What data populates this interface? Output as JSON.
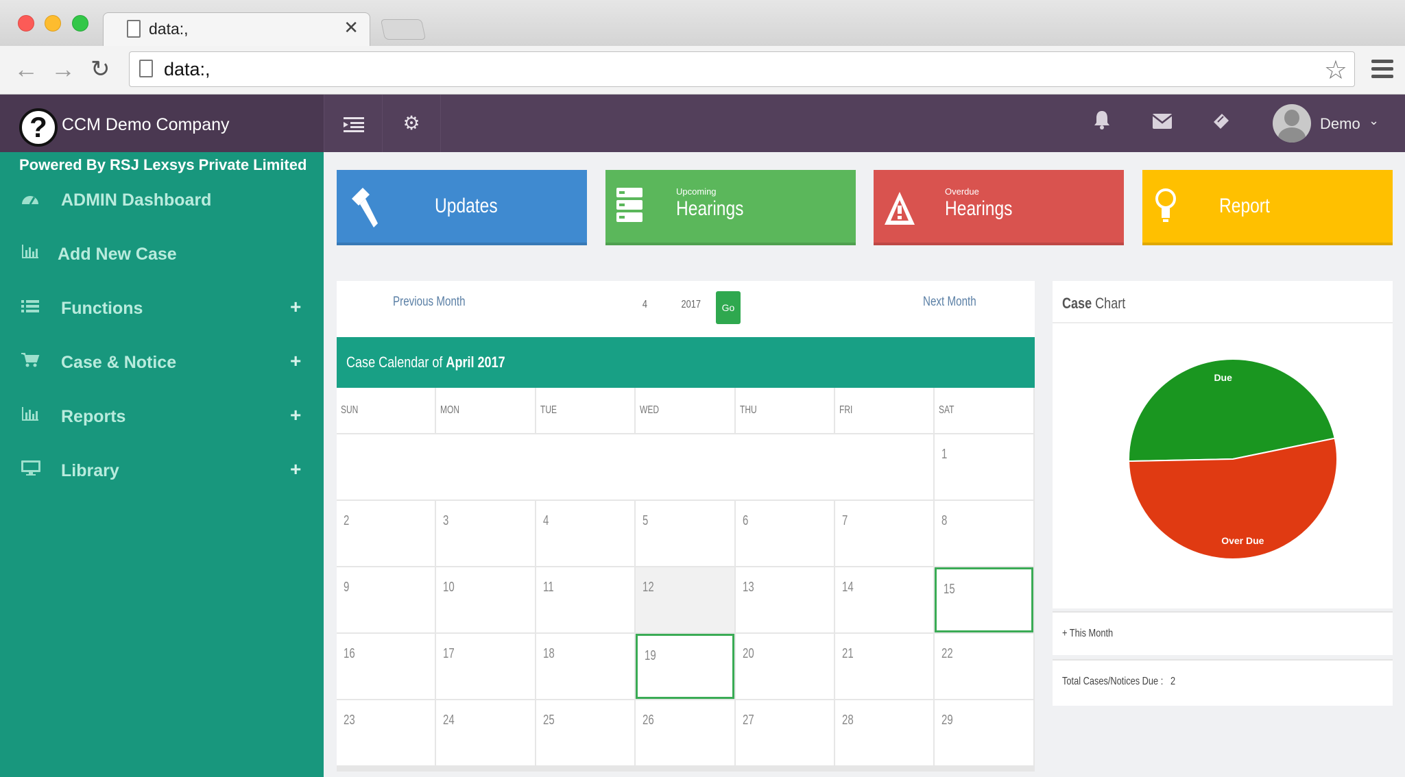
{
  "browser": {
    "tab_title": "data:,",
    "url": "data:,"
  },
  "header": {
    "company": "CCM Demo Company",
    "user_name": "Demo"
  },
  "sidebar": {
    "powered_by": "Powered By RSJ Lexsys Private Limited",
    "items": [
      {
        "label": "ADMIN Dashboard",
        "icon": "dashboard-icon",
        "expandable": false
      },
      {
        "label": "Add New Case",
        "icon": "bar-chart-icon",
        "expandable": false
      },
      {
        "label": "Functions",
        "icon": "list-icon",
        "expandable": true
      },
      {
        "label": "Case & Notice",
        "icon": "cart-icon",
        "expandable": true
      },
      {
        "label": "Reports",
        "icon": "bar-chart-icon",
        "expandable": true
      },
      {
        "label": "Library",
        "icon": "monitor-icon",
        "expandable": true
      }
    ]
  },
  "tiles": {
    "updates": {
      "label": "Updates",
      "color": "#3f8ad0"
    },
    "upcoming": {
      "small": "Upcoming",
      "label": "Hearings",
      "color": "#5bb75b"
    },
    "overdue": {
      "small": "Overdue",
      "label": "Hearings",
      "color": "#d9534f"
    },
    "report": {
      "label": "Report",
      "color": "#ffc000"
    }
  },
  "calendar_nav": {
    "previous": "Previous Month",
    "month_value": "4",
    "year_value": "2017",
    "go": "Go",
    "next": "Next Month"
  },
  "calendar": {
    "title_prefix": "Case Calendar of",
    "title_month": "April 2017",
    "days_of_week": [
      "SUN",
      "MON",
      "TUE",
      "WED",
      "THU",
      "FRI",
      "SAT"
    ],
    "weeks": [
      [
        "",
        "",
        "",
        "",
        "",
        "",
        "1"
      ],
      [
        "2",
        "3",
        "4",
        "5",
        "6",
        "7",
        "8"
      ],
      [
        "9",
        "10",
        "11",
        "12",
        "13",
        "14",
        "15"
      ],
      [
        "16",
        "17",
        "18",
        "19",
        "20",
        "21",
        "22"
      ],
      [
        "23",
        "24",
        "25",
        "26",
        "27",
        "28",
        "29"
      ]
    ],
    "highlighted_days": [
      "15",
      "19"
    ],
    "shaded_days": [
      "12"
    ]
  },
  "case_chart": {
    "title_bold": "Case",
    "title_rest": "Chart",
    "this_month": "+ This Month",
    "total_label": "Total Cases/Notices Due :",
    "total_value": "2"
  },
  "chart_data": {
    "type": "pie",
    "labels": [
      "Due",
      "Over Due"
    ],
    "values": [
      47,
      53
    ],
    "colors": [
      "#1a9620",
      "#e03a12"
    ]
  }
}
